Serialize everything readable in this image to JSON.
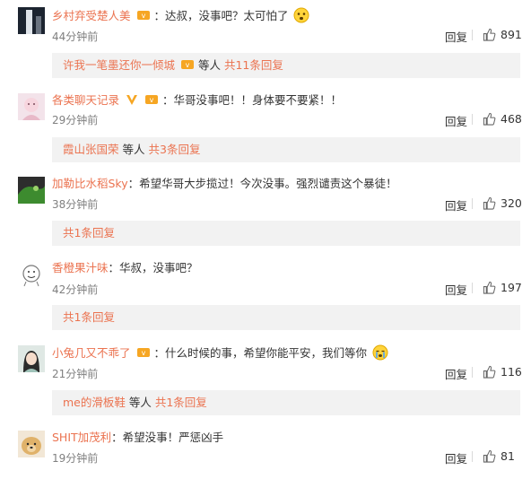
{
  "comments": [
    {
      "user": "乡村弃受楚人美",
      "text": "：达叔，没事吧？太可怕了",
      "time": "44分钟前",
      "reply_label": "回复",
      "likes": "891",
      "sub": {
        "users": "许我一笔墨还你一倾城",
        "suffix": "等人",
        "count": "共11条回复"
      }
    },
    {
      "user": "各类聊天记录",
      "text": "：华哥没事吧！！身体要不要紧！！",
      "time": "29分钟前",
      "reply_label": "回复",
      "likes": "468",
      "sub": {
        "users": "霞山张国荣",
        "suffix": "等人",
        "count": "共3条回复"
      }
    },
    {
      "user": "加勒比水稻Sky",
      "text": "：希望华哥大步揽过！今次没事。强烈谴责这个暴徒！",
      "time": "38分钟前",
      "reply_label": "回复",
      "likes": "320",
      "sub": {
        "count": "共1条回复"
      }
    },
    {
      "user": "香橙果汁味",
      "text": "：华叔，没事吧？",
      "time": "42分钟前",
      "reply_label": "回复",
      "likes": "197",
      "sub": {
        "count": "共1条回复"
      }
    },
    {
      "user": "小兔几又不乖了",
      "text": "：什么时候的事，希望你能平安，我们等你",
      "time": "21分钟前",
      "reply_label": "回复",
      "likes": "116",
      "sub": {
        "users": "me的滑板鞋",
        "suffix": "等人",
        "count": "共1条回复"
      }
    },
    {
      "user": "SHIT加茂利",
      "text": "：希望没事！严惩凶手",
      "time": "19分钟前",
      "reply_label": "回复",
      "likes": "81"
    }
  ],
  "colors": {
    "link": "#eb7350",
    "time": "#808080",
    "subbox": "#f2f2f2"
  }
}
